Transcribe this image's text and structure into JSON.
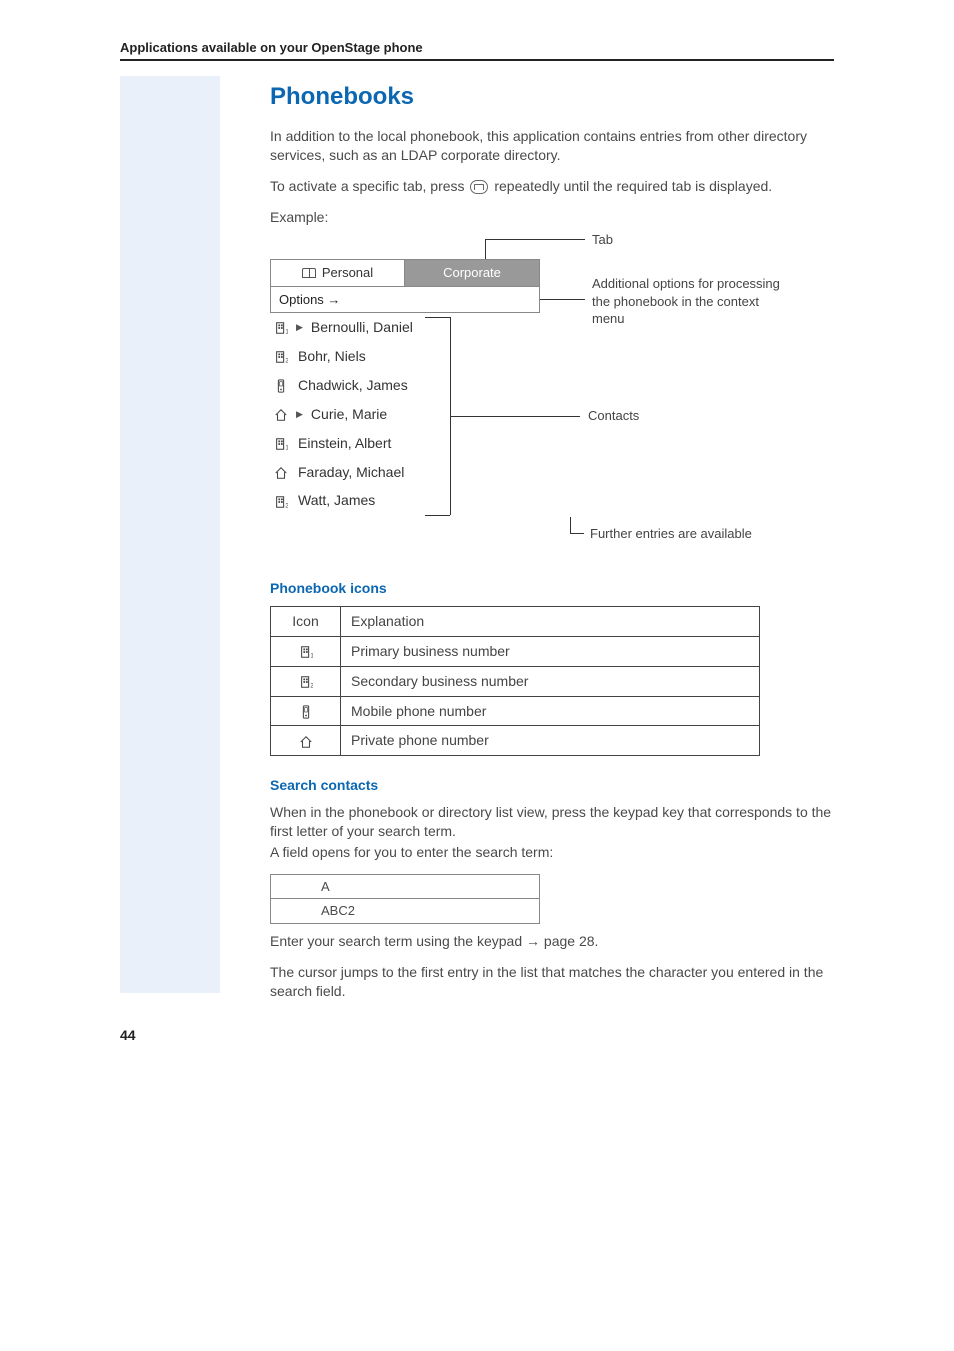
{
  "section_header": "Applications available on your OpenStage phone",
  "title": "Phonebooks",
  "intro1": "In addition to the local phonebook, this application contains entries from other directory services, such as an LDAP corporate directory.",
  "intro2a": "To activate a specific tab, press ",
  "intro2b": " repeatedly until the required tab is displayed.",
  "example_label": "Example:",
  "tabs": {
    "personal": "Personal",
    "corporate": "Corporate",
    "options": "Options →"
  },
  "annotations": {
    "tab": "Tab",
    "options": "Additional options for processing the phonebook in the context menu",
    "contacts": "Contacts",
    "more": "Further entries are available"
  },
  "contacts": [
    {
      "name": "Bernoulli, Daniel",
      "icon": "business1",
      "tri": true
    },
    {
      "name": "Bohr, Niels",
      "icon": "business2",
      "tri": false
    },
    {
      "name": "Chadwick, James",
      "icon": "mobile",
      "tri": false
    },
    {
      "name": "Curie, Marie",
      "icon": "home",
      "tri": true
    },
    {
      "name": "Einstein, Albert",
      "icon": "business1",
      "tri": false
    },
    {
      "name": "Faraday, Michael",
      "icon": "home",
      "tri": false
    },
    {
      "name": "Watt, James",
      "icon": "business2",
      "tri": false
    }
  ],
  "icons_heading": "Phonebook icons",
  "icons_table": {
    "th_icon": "Icon",
    "th_exp": "Explanation",
    "rows": [
      {
        "icon": "business1",
        "text": "Primary business number"
      },
      {
        "icon": "business2",
        "text": "Secondary business number"
      },
      {
        "icon": "mobile",
        "text": "Mobile phone number"
      },
      {
        "icon": "home",
        "text": "Private phone number"
      }
    ]
  },
  "search_heading": "Search contacts",
  "search_p1": "When in the phonebook or directory list view, press the keypad key that corresponds to the first letter of your search term.",
  "search_p2": "A field opens for you to enter the search term:",
  "search_box": {
    "line1": "A",
    "line2": "ABC2"
  },
  "search_p3a": "Enter your search term using the keypad ",
  "search_p3b": " page 28.",
  "search_p4": "The cursor jumps to the first entry in the list that matches the character you entered in the search field.",
  "page_number": "44"
}
